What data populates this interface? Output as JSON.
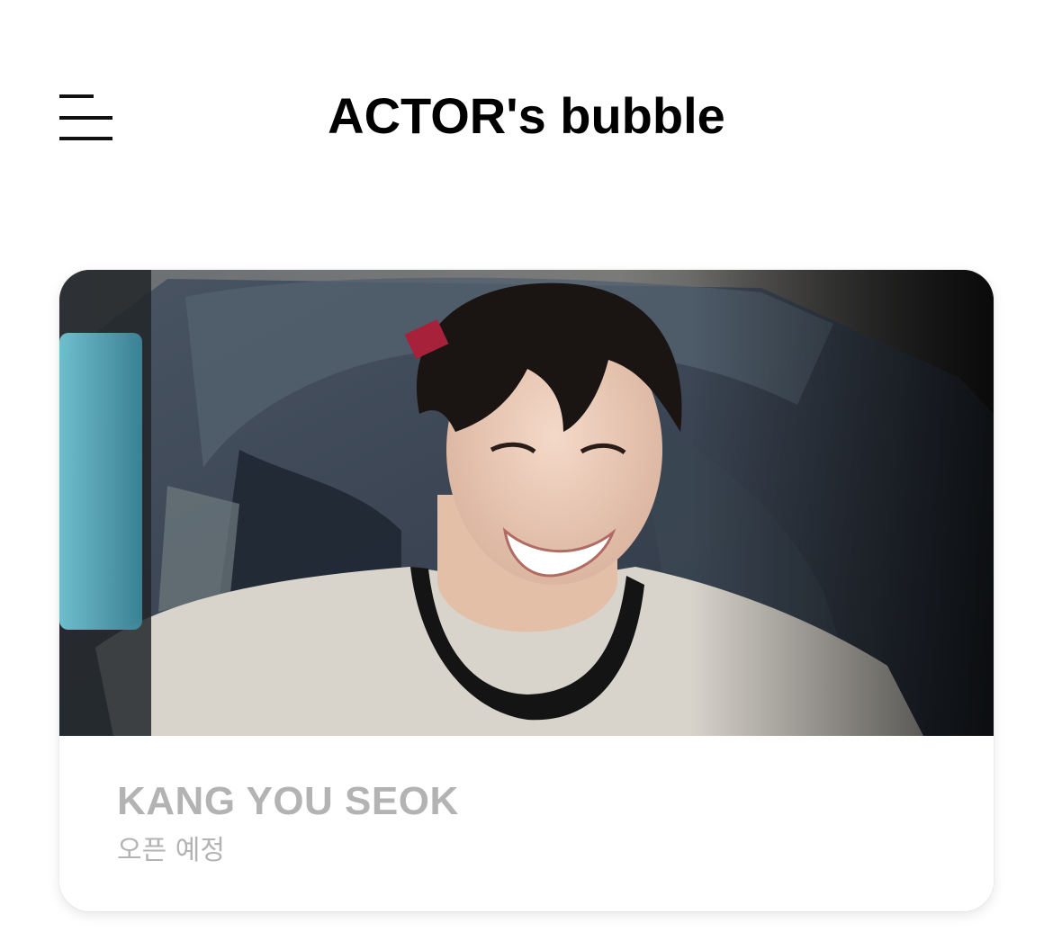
{
  "header": {
    "title": "ACTOR's bubble",
    "menu_icon": "hamburger-menu-icon"
  },
  "artist_card": {
    "name": "KANG YOU SEOK",
    "status": "오픈 예정",
    "photo_alt": "KANG YOU SEOK"
  },
  "colors": {
    "title": "#000000",
    "card_text_muted": "#b3b3b3",
    "background": "#ffffff"
  }
}
